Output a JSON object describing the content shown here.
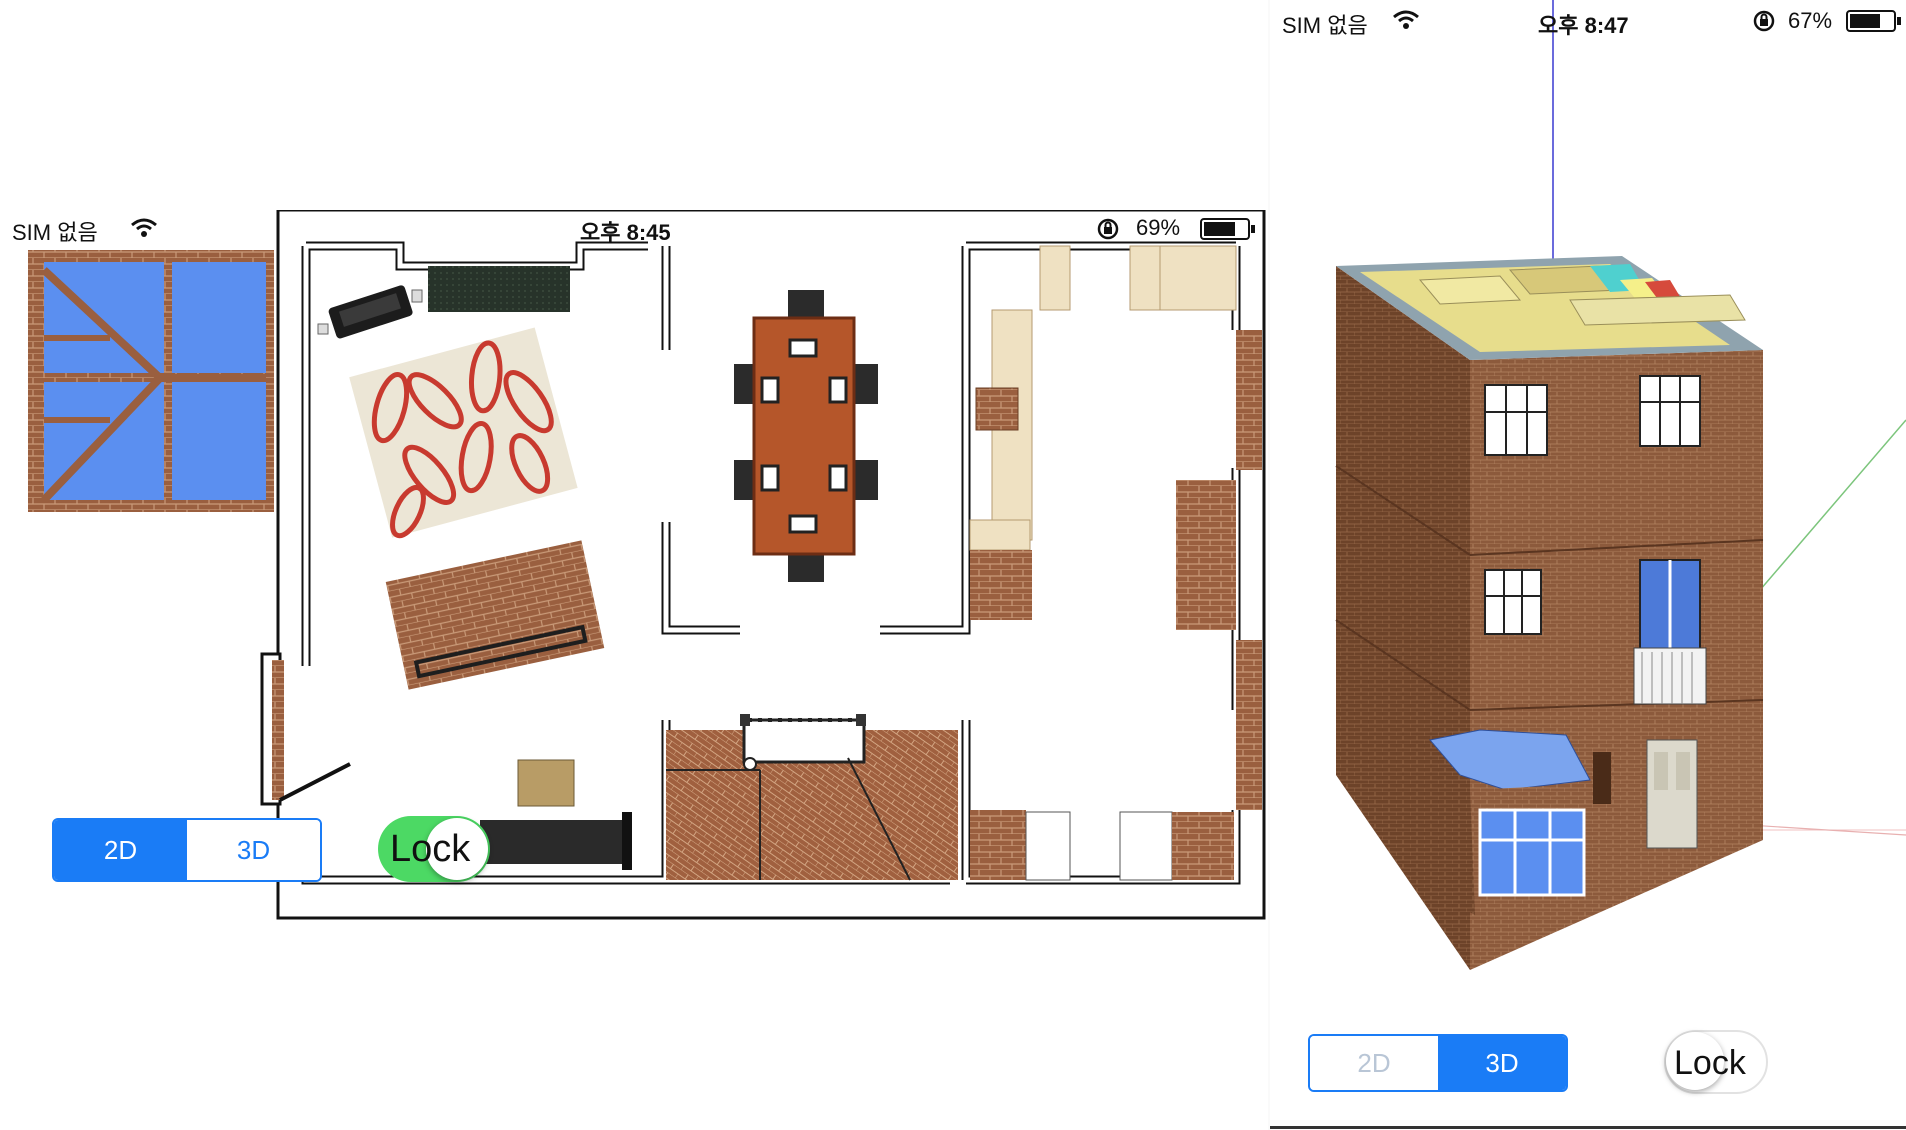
{
  "left_screen": {
    "status_bar": {
      "carrier": "SIM 없음",
      "time": "오후 8:45",
      "battery": "69%"
    },
    "view_mode": {
      "options": [
        "2D",
        "3D"
      ],
      "selected": "2D"
    },
    "lock_toggle": {
      "label": "Lock",
      "on": true
    },
    "view": "2D floor plan"
  },
  "right_screen": {
    "status_bar": {
      "carrier": "SIM 없음",
      "time": "오후 8:47",
      "battery": "67%"
    },
    "view_mode": {
      "options": [
        "2D",
        "3D"
      ],
      "selected": "3D"
    },
    "lock_toggle": {
      "label": "Lock",
      "on": false
    },
    "view": "3D house model"
  },
  "colors": {
    "accent": "#1a7cf6",
    "toggle_on": "#4cd964",
    "brick": "#8c5a3c",
    "glass": "#5b8ff0"
  },
  "icons": [
    "wifi-icon",
    "rotation-lock-icon",
    "battery-icon"
  ]
}
